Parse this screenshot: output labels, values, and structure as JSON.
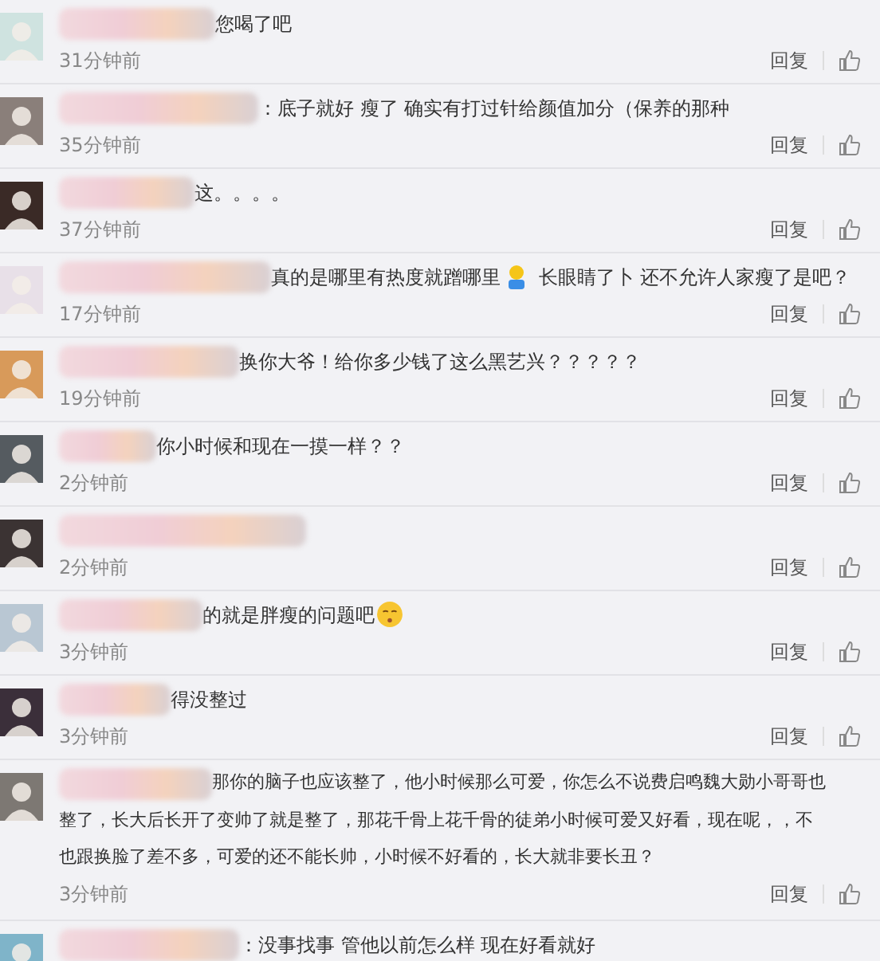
{
  "comments": [
    {
      "segments": [
        {
          "kind": "text",
          "text": "您喝了吧"
        }
      ],
      "time": "31分钟前",
      "reply": "回复"
    },
    {
      "segments": [
        {
          "kind": "text",
          "text": "：底子就好 瘦了 确实有打过针给颜值加分（保养的那种"
        }
      ],
      "time": "35分钟前",
      "reply": "回复"
    },
    {
      "segments": [
        {
          "kind": "text",
          "text": "这。。。。"
        }
      ],
      "time": "37分钟前",
      "reply": "回复"
    },
    {
      "segments": [
        {
          "kind": "text",
          "text": "真的是哪里有热度就蹭哪里"
        },
        {
          "kind": "figure"
        },
        {
          "kind": "text",
          "text": " 长眼睛了卜 还不允许人家瘦了是吧？"
        }
      ],
      "time": "17分钟前",
      "reply": "回复"
    },
    {
      "segments": [
        {
          "kind": "text",
          "text": "换你大爷！给你多少钱了这么黑艺兴？？？？？"
        }
      ],
      "time": "19分钟前",
      "reply": "回复"
    },
    {
      "segments": [
        {
          "kind": "text",
          "text": "你小时候和现在一摸一样？？"
        }
      ],
      "time": "2分钟前",
      "reply": "回复"
    },
    {
      "time": "2分钟前",
      "reply": "回复"
    },
    {
      "segments": [
        {
          "kind": "text",
          "text": "的就是胖瘦的问题吧"
        },
        {
          "kind": "face"
        }
      ],
      "time": "3分钟前",
      "reply": "回复"
    },
    {
      "segments": [
        {
          "kind": "text",
          "text": "得没整过"
        }
      ],
      "time": "3分钟前",
      "reply": "回复"
    },
    {
      "segments": [
        {
          "kind": "text",
          "text": "那你的脑子也应该整了，他小时候那么可爱，你怎么不说费启鸣魏大勋小哥哥也"
        }
      ],
      "more_lines": [
        "整了，长大后长开了变帅了就是整了，那花千骨上花千骨的徒弟小时候可爱又好看，现在呢，，不",
        "也跟换脸了差不多，可爱的还不能长帅，小时候不好看的，长大就非要长丑？"
      ],
      "time": "3分钟前",
      "reply": "回复"
    },
    {
      "segments": [
        {
          "kind": "text",
          "text": "：没事找事 管他以前怎么样 现在好看就好"
        }
      ]
    }
  ]
}
